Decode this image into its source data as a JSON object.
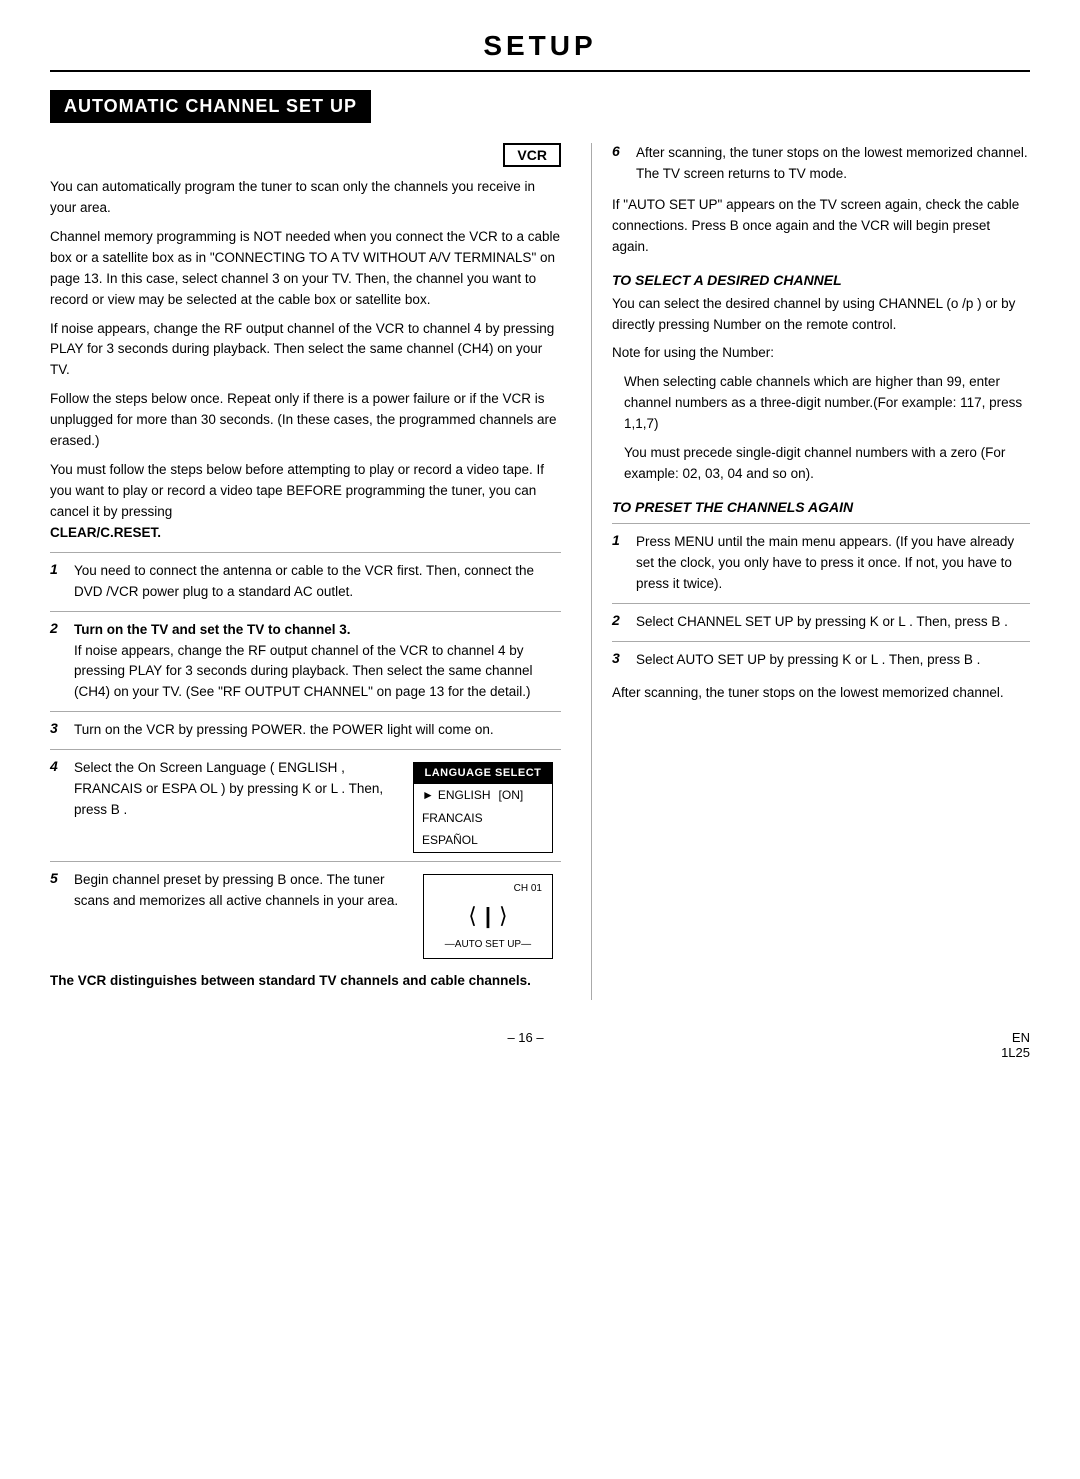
{
  "page": {
    "title": "SETUP",
    "section_header": "AUTOMATIC CHANNEL SET UP",
    "vcr_badge": "VCR",
    "footer_page": "– 16 –",
    "footer_code": "EN\n1L25"
  },
  "left": {
    "intro1": "You can automatically program the tuner to scan only the channels you receive in your area.",
    "intro2": "Channel memory programming is NOT needed when you connect the VCR to a cable box or a satellite box as in \"CONNECTING TO A TV WITHOUT A/V TERMINALS\" on page 13. In this case, select channel 3 on your TV. Then, the channel you want to record or view may be selected at the cable box or satellite box.",
    "intro3": "If noise appears, change the RF output channel of the VCR to channel 4 by pressing PLAY for 3 seconds during playback. Then select the same channel (CH4) on your TV.",
    "intro4": "Follow the steps below once. Repeat only if there is a power failure or if the VCR is unplugged for more than 30 seconds. (In these cases, the programmed channels are erased.)",
    "intro5": "You must follow the steps below before attempting to play or record a video tape. If you want to play or record a video tape BEFORE programming the tuner, you can cancel it by pressing",
    "clear_reset": "CLEAR/C.RESET.",
    "steps": [
      {
        "num": "1",
        "text": "You need to connect the antenna or cable to the VCR first. Then, connect the DVD /VCR power plug to a standard AC outlet."
      },
      {
        "num": "2",
        "text": "Turn on the TV and set the TV to channel 3.",
        "extra": "If noise appears, change the RF output channel of the VCR to channel 4 by pressing PLAY for 3 seconds during playback. Then select the same channel (CH4) on your TV. (See \"RF OUTPUT CHANNEL\" on page 13 for the detail.)"
      },
      {
        "num": "3",
        "text": "Turn on the VCR by pressing POWER. the POWER light will come on."
      },
      {
        "num": "4",
        "text": "Select the On Screen Language ( ENGLISH , FRANCAIS or ESPA OL ) by pressing K or L . Then, press B .",
        "language_box": {
          "header": "LANGUAGE SELECT",
          "items": [
            {
              "active": true,
              "prefix": "►",
              "label": "ENGLISH",
              "tag": "[ON]"
            },
            {
              "active": false,
              "label": "FRANCAIS"
            },
            {
              "active": false,
              "label": "ESPAÑOL"
            }
          ]
        }
      },
      {
        "num": "5",
        "text": "Begin channel preset by pressing B once. The tuner scans and memorizes all active channels in your area.",
        "ch_box": {
          "ch_label": "CH 01",
          "auto_label": "—AUTO SET UP—"
        }
      }
    ],
    "vcr_note": "The VCR distinguishes between standard TV channels and cable channels."
  },
  "right": {
    "step6": {
      "num": "6",
      "text": "After scanning, the tuner stops on the lowest memorized channel. The TV screen returns to TV mode."
    },
    "auto_note": "If \"AUTO SET UP\" appears on the TV screen again, check the cable connections. Press B once again and the VCR will begin preset again.",
    "subsection1_title": "TO SELECT A DESIRED CHANNEL",
    "subsection1_text1": "You can select the desired channel by using CHANNEL (o /p ) or by directly pressing Number on the remote control.",
    "subsection1_note_header": "Note for using the Number:",
    "subsection1_note1": "When selecting cable channels which are higher than 99, enter channel numbers as a three-digit number.(For example: 117, press 1,1,7)",
    "subsection1_note2": "You must precede single-digit channel numbers with a zero (For example: 02, 03, 04 and so on).",
    "subsection2_title": "TO PRESET THE CHANNELS AGAIN",
    "preset_steps": [
      {
        "num": "1",
        "text": "Press MENU until the main menu appears. (If you have already set the clock, you only have to press it once. If not, you have to press it twice)."
      },
      {
        "num": "2",
        "text": "Select  CHANNEL SET UP  by pressing  K or L . Then, press  B ."
      },
      {
        "num": "3",
        "text": "Select  AUTO SET UP  by pressing  K or L . Then, press  B ."
      }
    ],
    "after_scan": "After scanning, the tuner stops on the lowest memorized channel."
  }
}
